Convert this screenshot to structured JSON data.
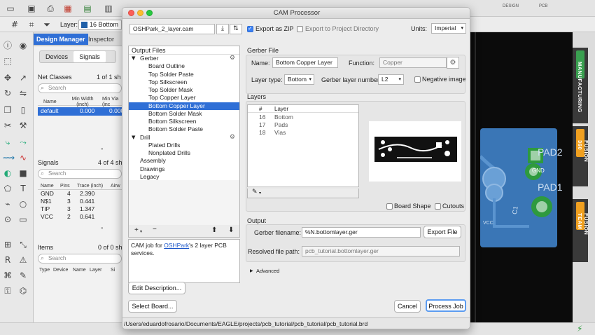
{
  "toolbar": {
    "layer_label": "Layer:",
    "layer_value": "16 Bottom",
    "design_short": "DESIGN",
    "pcb_short": "PCB"
  },
  "design_manager": {
    "tabs": [
      "Design Manager",
      "Inspector"
    ],
    "subtabs": [
      "Devices",
      "Signals"
    ],
    "net_classes": {
      "title": "Net Classes",
      "count": "1 of 1 sh",
      "search_placeholder": "Search",
      "headers": [
        "Name",
        "Min Width (inch)",
        "Min Via (inc"
      ],
      "rows": [
        {
          "name": "default",
          "width": "0.000",
          "via": "0.000"
        }
      ]
    },
    "signals": {
      "title": "Signals",
      "count": "4 of 4 sh",
      "search_placeholder": "Search",
      "headers": [
        "Name",
        "Pins",
        "Trace (inch)",
        "Airw"
      ],
      "rows": [
        {
          "name": "GND",
          "pins": "4",
          "trace": "2.390"
        },
        {
          "name": "N$1",
          "pins": "3",
          "trace": "0.441"
        },
        {
          "name": "TIP",
          "pins": "3",
          "trace": "1.347"
        },
        {
          "name": "VCC",
          "pins": "2",
          "trace": "0.641"
        }
      ]
    },
    "items": {
      "title": "Items",
      "count": "0 of 0 sh",
      "search_placeholder": "Search",
      "headers": [
        "Type",
        "Device",
        "Name",
        "Layer",
        "Si"
      ]
    }
  },
  "cam": {
    "title": "CAM Processor",
    "job_file": "OSHPark_2_layer.cam",
    "export_zip_label": "Export as ZIP",
    "export_zip_checked": true,
    "export_project_label": "Export to Project Directory",
    "export_project_checked": false,
    "units_label": "Units:",
    "units_value": "Imperial",
    "output_files_title": "Output Files",
    "tree": [
      {
        "label": "Gerber",
        "level": 0,
        "expanded": true,
        "gear": true
      },
      {
        "label": "Board Outline",
        "level": 1
      },
      {
        "label": "Top Solder Paste",
        "level": 1
      },
      {
        "label": "Top Silkscreen",
        "level": 1
      },
      {
        "label": "Top Solder Mask",
        "level": 1
      },
      {
        "label": "Top Copper Layer",
        "level": 1
      },
      {
        "label": "Bottom Copper Layer",
        "level": 1,
        "selected": true
      },
      {
        "label": "Bottom Solder Mask",
        "level": 1
      },
      {
        "label": "Bottom Silkscreen",
        "level": 1
      },
      {
        "label": "Bottom Solder Paste",
        "level": 1
      },
      {
        "label": "Drill",
        "level": 0,
        "expanded": true,
        "gear": true
      },
      {
        "label": "Plated Drills",
        "level": 1
      },
      {
        "label": "Nonplated Drills",
        "level": 1
      },
      {
        "label": "Assembly",
        "level": 0
      },
      {
        "label": "Drawings",
        "level": 0
      },
      {
        "label": "Legacy",
        "level": 0
      }
    ],
    "description_before": "CAM job for ",
    "description_link": "OSHPark",
    "description_after": "'s 2 layer PCB services.",
    "edit_description_button": "Edit Description...",
    "select_board_button": "Select Board...",
    "gerber_file": {
      "section_title": "Gerber File",
      "name_label": "Name:",
      "name_value": "Bottom Copper Layer",
      "function_label": "Function:",
      "function_placeholder": "Copper",
      "layer_type_label": "Layer type:",
      "layer_type_value": "Bottom",
      "gerber_layer_label": "Gerber layer number",
      "gerber_layer_value": "L2",
      "negative_label": "Negative image",
      "negative_checked": false
    },
    "layers": {
      "section_title": "Layers",
      "headers": [
        "#",
        "Layer"
      ],
      "rows": [
        {
          "num": "16",
          "name": "Bottom"
        },
        {
          "num": "17",
          "name": "Pads"
        },
        {
          "num": "18",
          "name": "Vias"
        }
      ],
      "board_shape_label": "Board Shape",
      "board_shape_checked": false,
      "cutouts_label": "Cutouts",
      "cutouts_checked": false
    },
    "output": {
      "section_title": "Output",
      "gerber_filename_label": "Gerber filename:",
      "gerber_filename_value": "%N.bottomlayer.ger",
      "export_file_button": "Export File",
      "resolved_label": "Resolved file path:",
      "resolved_value": "pcb_tutorial.bottomlayer.ger",
      "advanced_label": "Advanced"
    },
    "cancel_button": "Cancel",
    "process_button": "Process Job",
    "path": "/Users/eduardofrosario/Documents/EAGLE/projects/pcb_tutorial/pcb_tutorial/pcb_tutorial.brd"
  },
  "board_labels": {
    "pad2": "PAD2",
    "pad1": "PAD1",
    "gnd": "GND",
    "c1": "C1",
    "vcc": "VCC"
  },
  "side_tabs": [
    "MANUFACTURING",
    "FUSION 360",
    "FUSION TEAM"
  ],
  "colors": {
    "accent": "#2f6fd6",
    "board_blue": "#3a76b6",
    "cam_tab_orange": "#f0a020",
    "mfg_green": "#3aa050"
  }
}
